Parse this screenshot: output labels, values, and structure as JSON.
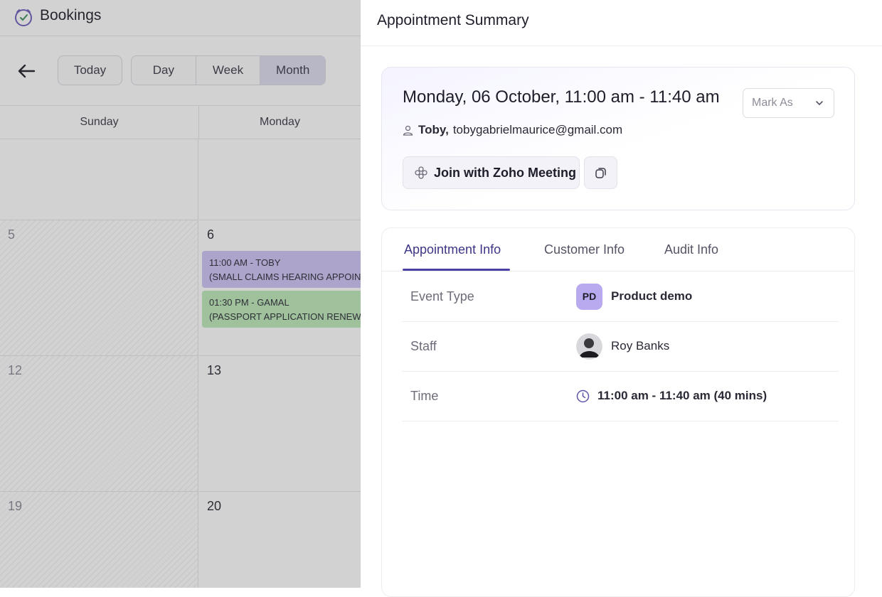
{
  "calendar": {
    "app_title": "Bookings",
    "buttons": {
      "today": "Today",
      "day": "Day",
      "week": "Week",
      "month": "Month"
    },
    "columns": [
      "Sunday",
      "Monday"
    ],
    "weeks": [
      {
        "sunday": "",
        "monday": ""
      },
      {
        "sunday": "5",
        "monday": "6"
      },
      {
        "sunday": "12",
        "monday": "13"
      },
      {
        "sunday": "19",
        "monday": "20"
      }
    ],
    "events": [
      {
        "line1": "11:00 AM - TOBY",
        "line2": "(SMALL CLAIMS HEARING APPOINTMENT)",
        "color": "#cfc3f7"
      },
      {
        "line1": "01:30 PM - GAMAL",
        "line2": "(PASSPORT APPLICATION RENEWAL)",
        "color": "#bde9b9"
      }
    ]
  },
  "summary": {
    "panel_title": "Appointment Summary",
    "date_time": "Monday, 06 October, 11:00 am - 11:40 am",
    "mark_as": "Mark As",
    "customer_name": "Toby,",
    "customer_email": "tobygabrielmaurice@gmail.com",
    "join_label": "Join with Zoho Meeting",
    "tabs": [
      "Appointment Info",
      "Customer Info",
      "Audit Info"
    ],
    "active_tab": "Appointment Info",
    "rows": {
      "event_type": {
        "label": "Event Type",
        "badge": "PD",
        "value": "Product demo"
      },
      "staff": {
        "label": "Staff",
        "value": "Roy Banks"
      },
      "time": {
        "label": "Time",
        "value": "11:00 am - 11:40 am (40 mins)"
      }
    }
  },
  "colors": {
    "accent": "#4b41a5",
    "event_purple": "#cfc3f7",
    "event_green": "#bde9b9",
    "badge": "#b9a9ee"
  }
}
